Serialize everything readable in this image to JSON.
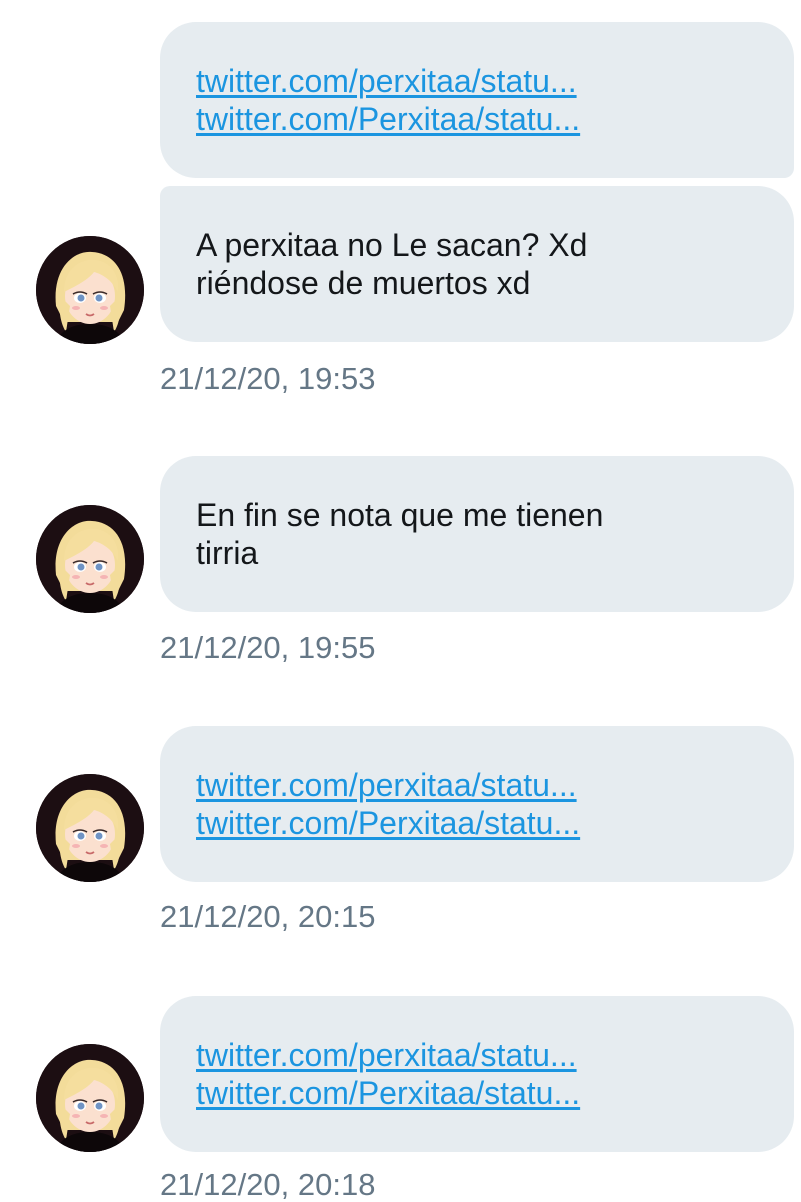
{
  "messages": [
    {
      "lines": [
        "twitter.com/perxitaa/statu...",
        "twitter.com/Perxitaa/statu..."
      ]
    },
    {
      "lines": [
        "A perxitaa no Le sacan? Xd",
        "riéndose de muertos xd"
      ],
      "timestamp": "21/12/20, 19:53"
    },
    {
      "lines": [
        "En fin se nota que me tienen",
        "tirria"
      ],
      "timestamp": "21/12/20, 19:55"
    },
    {
      "lines": [
        "twitter.com/perxitaa/statu...",
        "twitter.com/Perxitaa/statu..."
      ],
      "timestamp": "21/12/20, 20:15"
    },
    {
      "lines": [
        "twitter.com/perxitaa/statu...",
        "twitter.com/Perxitaa/statu..."
      ],
      "timestamp": "21/12/20, 20:18"
    }
  ],
  "colors": {
    "bubble_bg": "#e6ecf0",
    "link": "#1b95e0",
    "text": "#14171a",
    "timestamp": "#657786"
  },
  "icons": {
    "avatar": "avatar-icon"
  }
}
